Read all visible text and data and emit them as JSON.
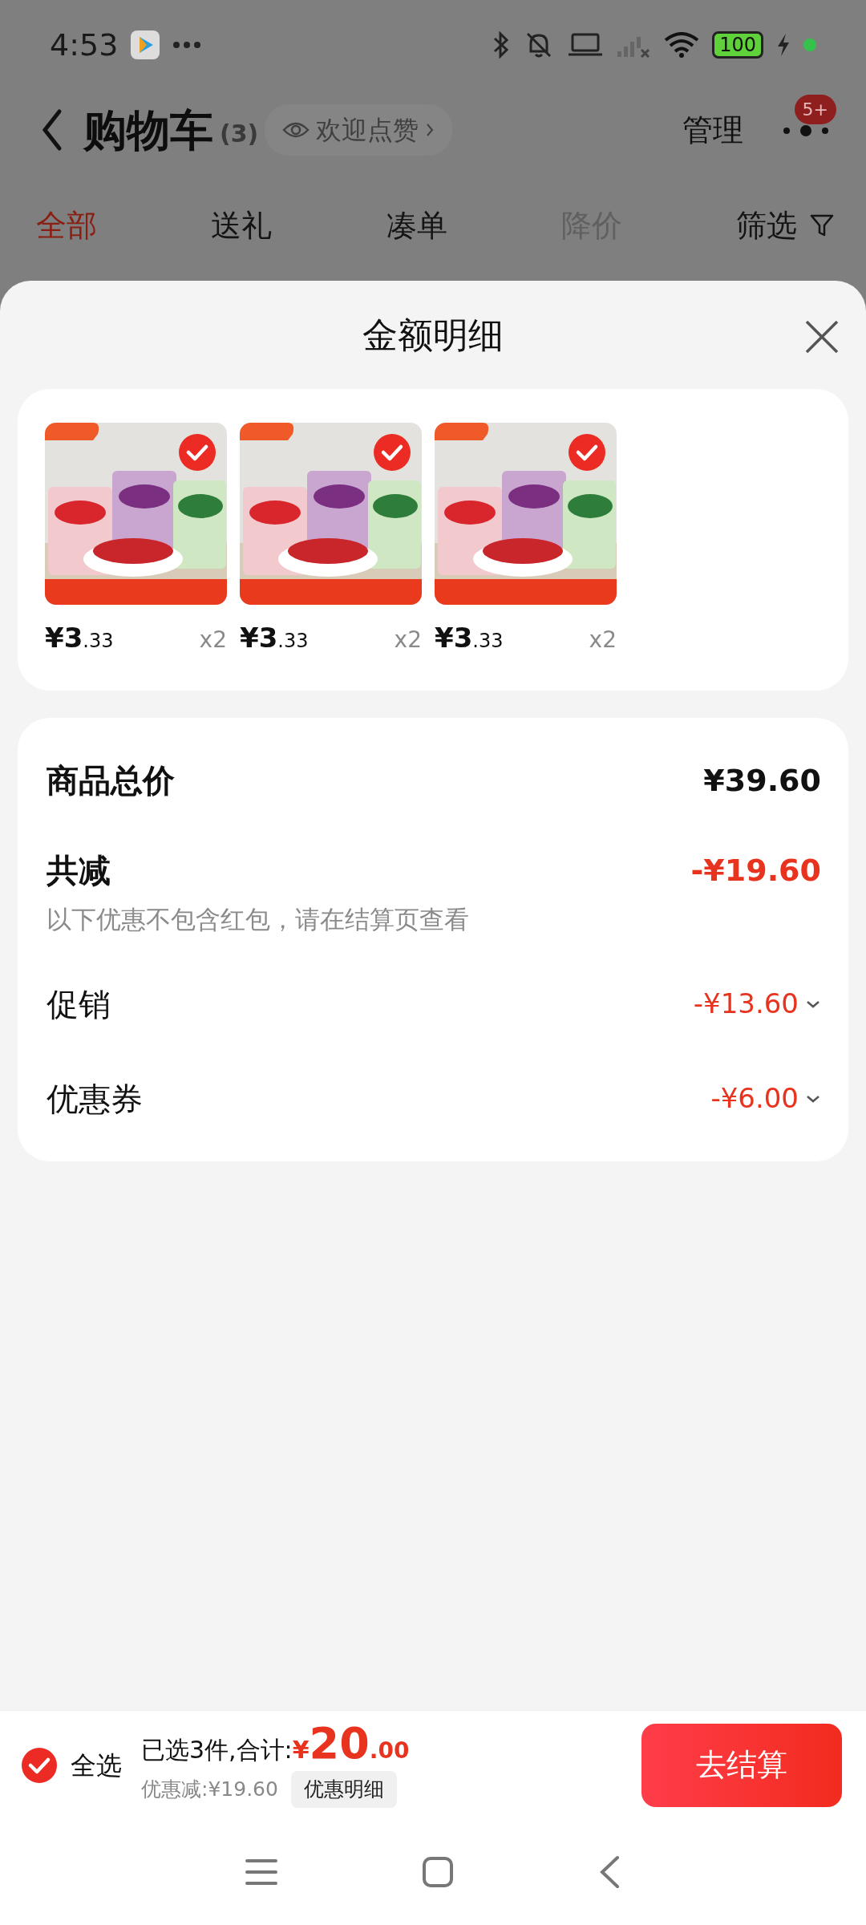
{
  "status_bar": {
    "time": "4:53",
    "battery": "100"
  },
  "header": {
    "title": "购物车",
    "count": "(3)",
    "like_chip": "欢迎点赞",
    "manage": "管理",
    "badge": "5+"
  },
  "tabs": [
    {
      "label": "全部",
      "selected": true,
      "disabled": false
    },
    {
      "label": "送礼",
      "selected": false,
      "disabled": false
    },
    {
      "label": "凑单",
      "selected": false,
      "disabled": false
    },
    {
      "label": "降价",
      "selected": false,
      "disabled": true
    }
  ],
  "filter": {
    "label": "筛选"
  },
  "sheet": {
    "title": "金额明细",
    "products": [
      {
        "kind": "picture",
        "price_main": "¥3",
        "price_decimal": ".33",
        "quantity": "x2",
        "selected": true
      },
      {
        "kind": "picture",
        "price_main": "¥3",
        "price_decimal": ".33",
        "quantity": "x2",
        "selected": true
      },
      {
        "kind": "picture",
        "price_main": "¥3",
        "price_decimal": ".33",
        "quantity": "x2",
        "selected": true
      }
    ],
    "summary": [
      {
        "kind": "total",
        "label": "商品总价",
        "amount": "¥39.60"
      },
      {
        "kind": "discount",
        "label": "共减",
        "amount": "-¥19.60",
        "note": "以下优惠不包含红包，请在结算页查看"
      },
      {
        "kind": "detail",
        "label": "促销",
        "amount": "-¥13.60",
        "expandable": true
      },
      {
        "kind": "detail",
        "label": "优惠券",
        "amount": "-¥6.00",
        "expandable": true
      }
    ]
  },
  "bottom_bar": {
    "select_all": {
      "label": "全选",
      "checked": true
    },
    "selected_text": "已选3件,合计:",
    "currency": "¥",
    "total_main": "20",
    "total_decimal": ".00",
    "discount_text": "优惠减:¥19.60",
    "detail_button": "优惠明细",
    "checkout": "去结算"
  }
}
